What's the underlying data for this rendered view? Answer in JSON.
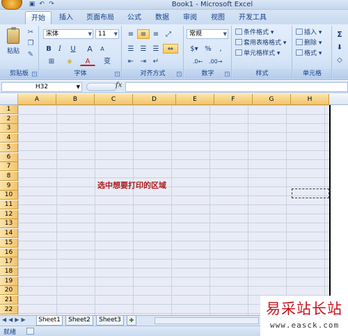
{
  "window": {
    "title": "Book1 - Microsoft Excel"
  },
  "qat": {
    "icons": [
      "save-icon",
      "undo-icon",
      "redo-icon"
    ]
  },
  "tabs": [
    "开始",
    "插入",
    "页面布局",
    "公式",
    "数据",
    "审阅",
    "视图",
    "开发工具"
  ],
  "ribbon": {
    "clipboard": {
      "paste_label": "粘贴",
      "group_label": "剪贴板"
    },
    "font": {
      "font_name": "宋体",
      "font_size": "11",
      "group_label": "字体",
      "bold": "B",
      "italic": "I",
      "underline": "U",
      "grow": "A",
      "shrink": "A",
      "color": "A",
      "wen": "变"
    },
    "alignment": {
      "group_label": "对齐方式"
    },
    "number": {
      "format": "常规",
      "group_label": "数字",
      "percent": "%",
      "comma": ","
    },
    "styles": {
      "group_label": "样式",
      "items": [
        "条件格式",
        "套用表格格式",
        "单元格样式"
      ]
    },
    "cells": {
      "group_label": "单元格",
      "items": [
        "插入",
        "删除",
        "格式"
      ]
    },
    "editing": {
      "items": [
        "Σ"
      ]
    }
  },
  "formula_bar": {
    "name_box": "H32",
    "fx_label": "fx",
    "formula": ""
  },
  "grid": {
    "columns": [
      "A",
      "B",
      "C",
      "D",
      "E",
      "F",
      "G",
      "H"
    ],
    "rows": [
      "1",
      "2",
      "3",
      "4",
      "5",
      "6",
      "7",
      "8",
      "9",
      "10",
      "11",
      "12",
      "13",
      "14",
      "15",
      "16",
      "17",
      "18",
      "19",
      "20",
      "21",
      "22"
    ],
    "annotation": "选中想要打印的区域"
  },
  "sheets": {
    "tabs": [
      "Sheet1",
      "Sheet2",
      "Sheet3"
    ],
    "active": "Sheet1"
  },
  "status": {
    "text": "就绪"
  },
  "watermark": {
    "name": "易采站长站",
    "url": "www.easck.com"
  },
  "colors": {
    "accent": "#15428b",
    "selection_header": "#f4c46c",
    "selection_fill": "#e9ecf6",
    "annotation": "#b01a1a",
    "watermark": "#c8131c"
  }
}
